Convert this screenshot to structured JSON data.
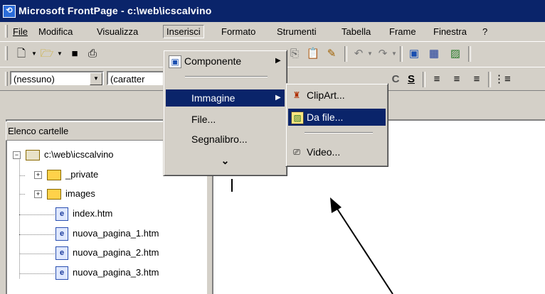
{
  "window": {
    "title": "Microsoft FrontPage - c:\\web\\icscalvino"
  },
  "menubar": {
    "items": [
      "File",
      "Modifica",
      "Visualizza",
      "Inserisci",
      "Formato",
      "Strumenti",
      "Tabella",
      "Frame",
      "Finestra",
      "?"
    ],
    "open_item": "Inserisci"
  },
  "format_toolbar": {
    "style_value": "(nessuno)",
    "font_value": "(caratter"
  },
  "folder_panel": {
    "header": "Elenco cartelle",
    "root": "c:\\web\\icscalvino",
    "folders": [
      "_private",
      "images"
    ],
    "files": [
      "index.htm",
      "nuova_pagina_1.htm",
      "nuova_pagina_2.htm",
      "nuova_pagina_3.htm"
    ]
  },
  "insert_menu": {
    "component": "Componente",
    "image": "Immagine",
    "file": "File...",
    "bookmark": "Segnalibro...",
    "expand_glyph": "⌄"
  },
  "image_submenu": {
    "clipart": "ClipArt...",
    "from_file": "Da file...",
    "video": "Video..."
  },
  "colors": {
    "titlebar": "#0a246a",
    "highlight": "#0a246a",
    "face": "#d4d0c8"
  }
}
